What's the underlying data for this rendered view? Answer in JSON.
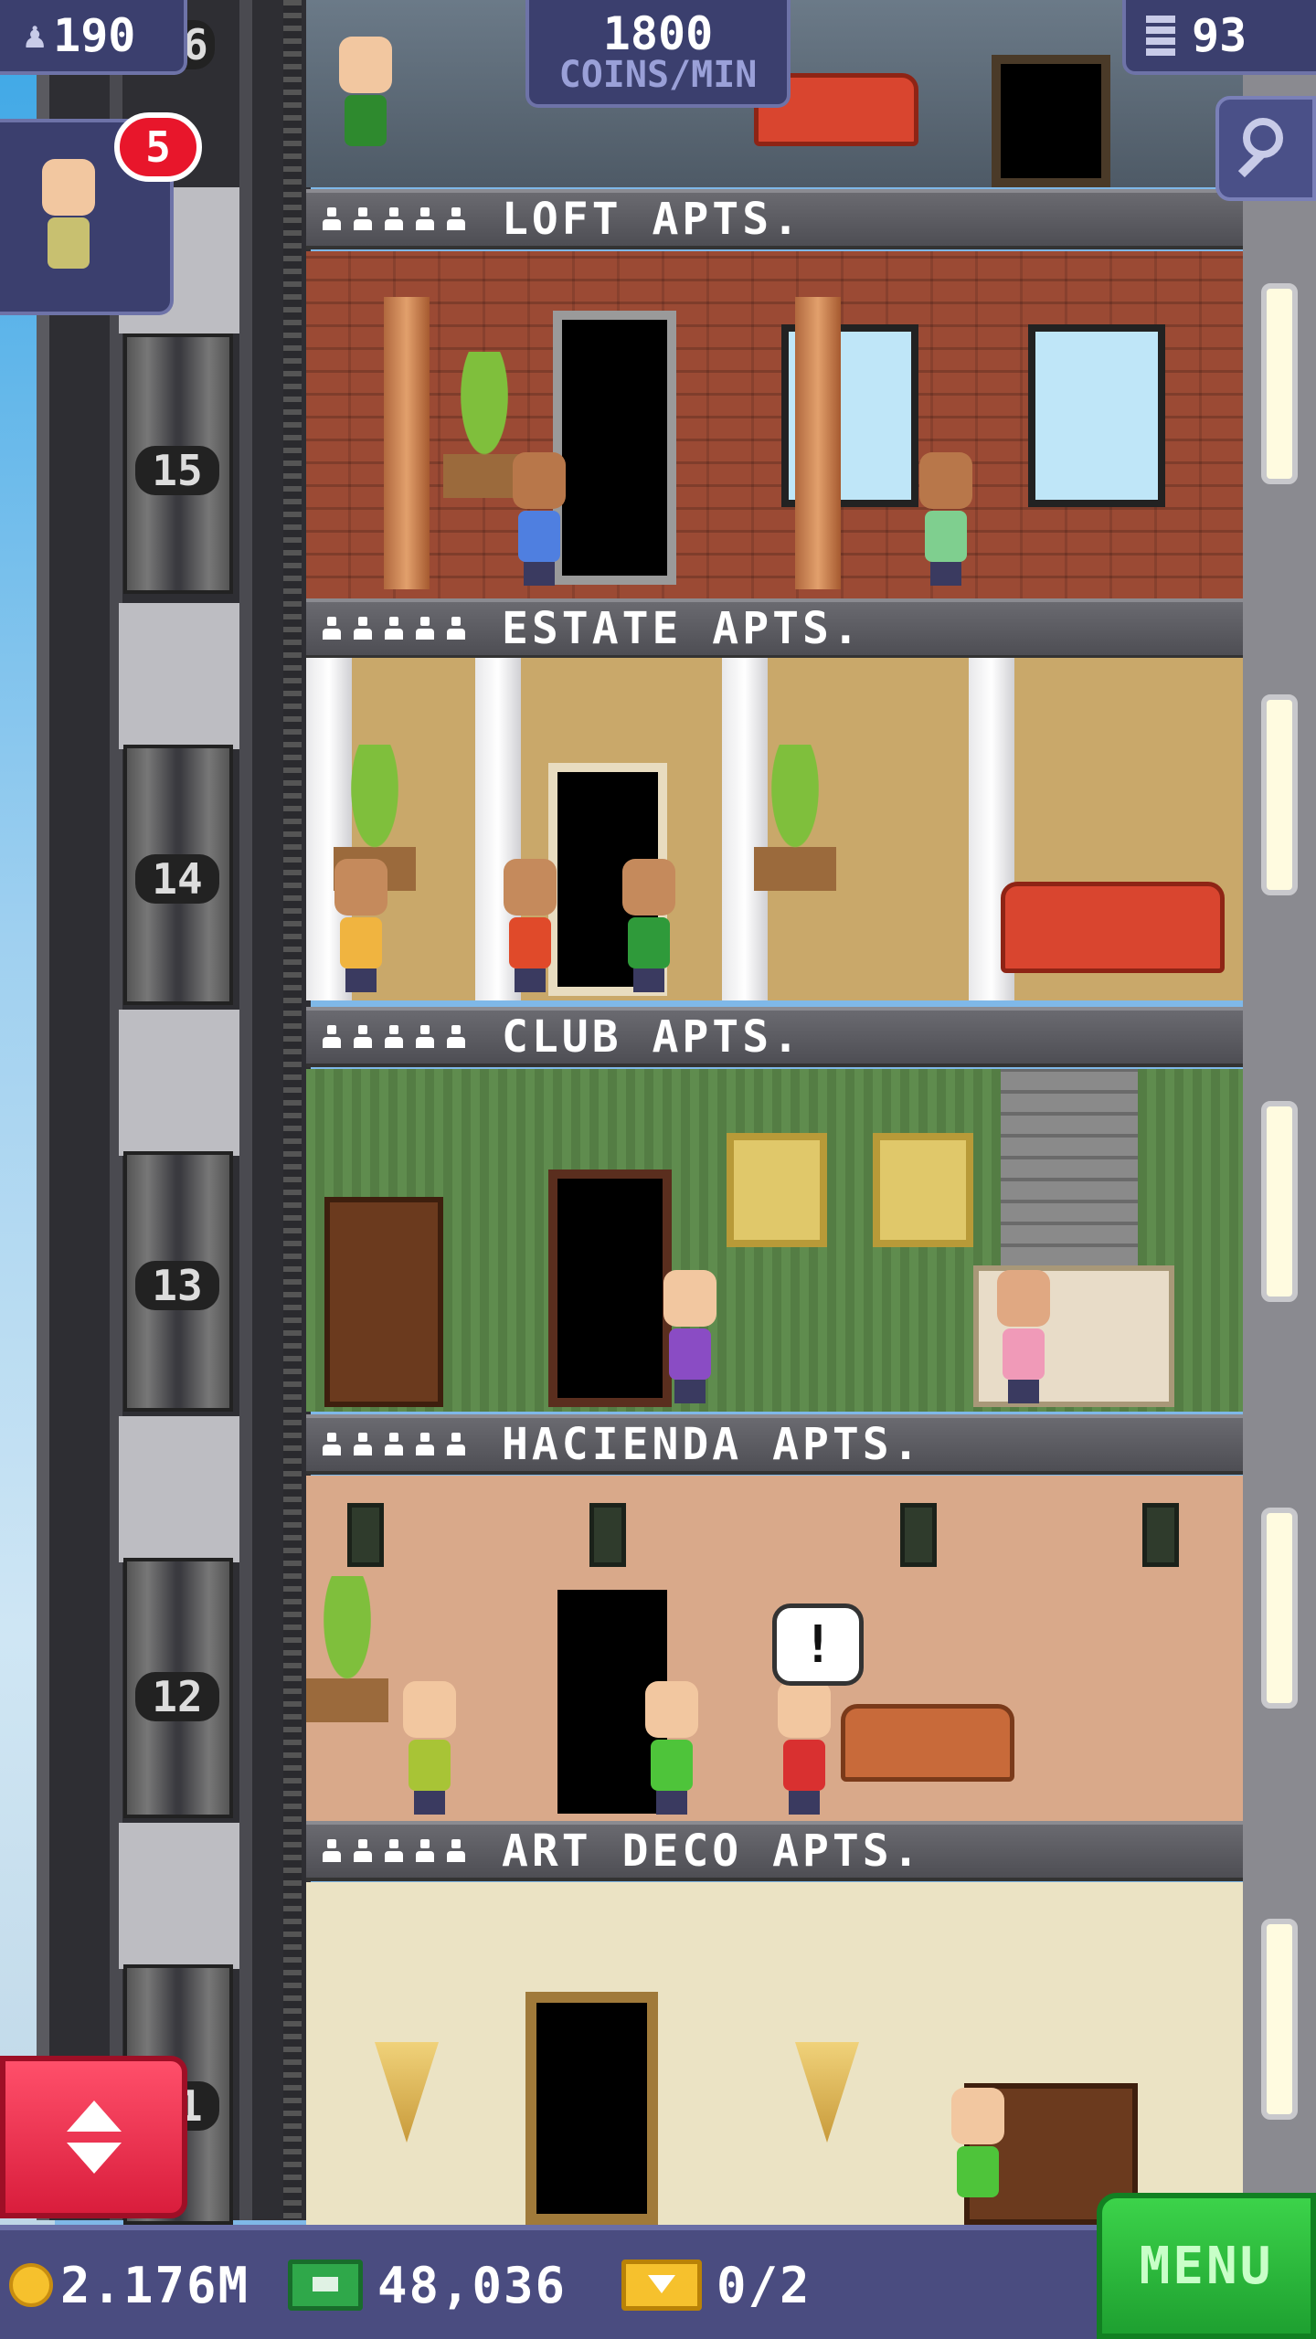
{
  "hud": {
    "population": "190",
    "coins_per_min_value": "1800",
    "coins_per_min_label": "COINS/MIN",
    "floors": "93",
    "notification_count": "5"
  },
  "floors": [
    {
      "number": "15",
      "name": "LOFT APTS."
    },
    {
      "number": "14",
      "name": "ESTATE APTS."
    },
    {
      "number": "13",
      "name": "CLUB APTS."
    },
    {
      "number": "12",
      "name": "HACIENDA APTS."
    },
    {
      "number": "11",
      "name": "ART DECO APTS."
    }
  ],
  "top_floor_number": "16",
  "speech_bubble": "!",
  "bottom_bar": {
    "coins": "2.176M",
    "bux": "48,036",
    "tickets": "0/2",
    "menu_label": "MENU"
  },
  "colors": {
    "hud_bg": "#3b3f6e",
    "menu_green": "#2bc23c",
    "elevator_button_red": "#e8314f",
    "badge_red": "#e8162b"
  },
  "icons": [
    "person-icon",
    "building-icon",
    "search-icon",
    "coin-icon",
    "bux-icon",
    "ticket-icon",
    "elevator-updown-icon"
  ]
}
